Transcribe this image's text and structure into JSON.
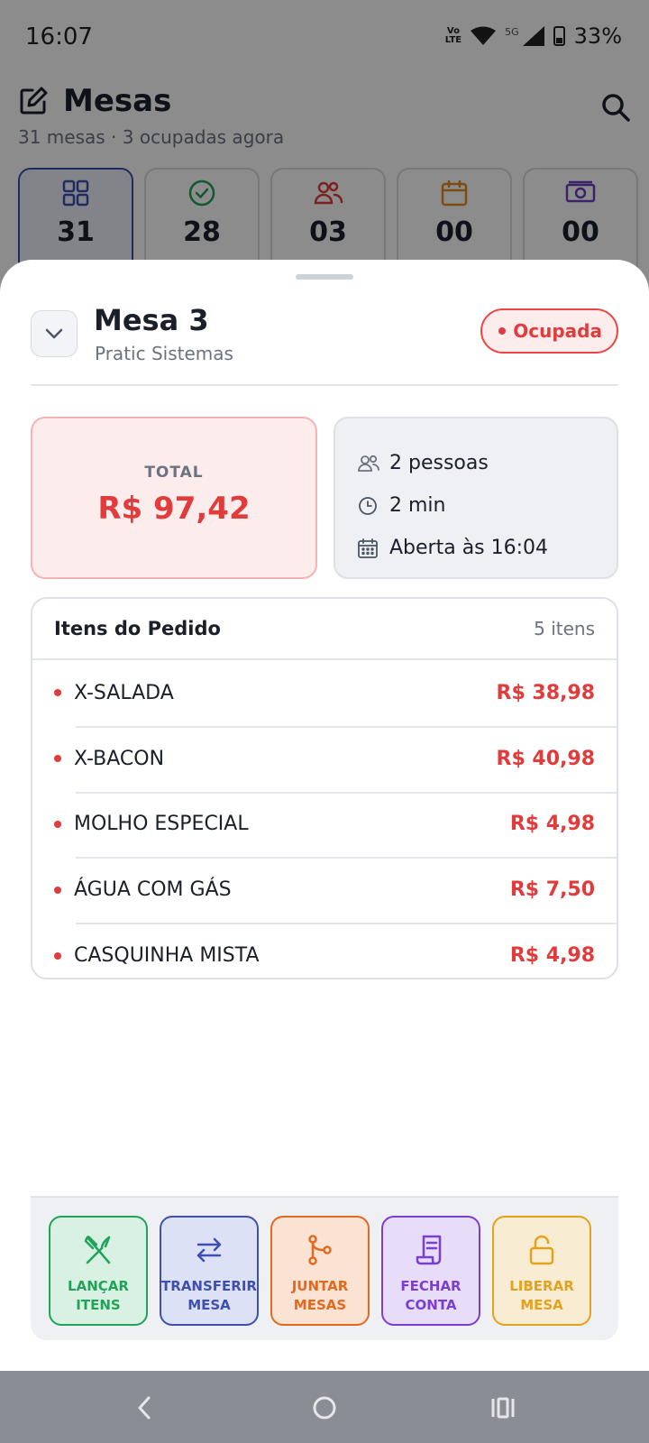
{
  "status_bar": {
    "time": "16:07",
    "volte_top": "Vo",
    "volte_bottom": "LTE",
    "network": "5G",
    "battery": "33%"
  },
  "page": {
    "title": "Mesas",
    "subtitle": "31 mesas · 3 ocupadas agora",
    "stats": [
      {
        "value": "31",
        "icon": "grid-icon",
        "color": "#3f4fb0"
      },
      {
        "value": "28",
        "icon": "check-circle-icon",
        "color": "#22a35a"
      },
      {
        "value": "03",
        "icon": "users-icon",
        "color": "#e23b3b"
      },
      {
        "value": "00",
        "icon": "calendar-icon",
        "color": "#e38a1a"
      },
      {
        "value": "00",
        "icon": "money-icon",
        "color": "#6b3fc4"
      }
    ]
  },
  "sheet": {
    "title": "Mesa 3",
    "subtitle": "Pratic Sistemas",
    "status_badge": "Ocupada",
    "total_label": "TOTAL",
    "total_value": "R$ 97,42",
    "info": {
      "people": "2 pessoas",
      "elapsed": "2 min",
      "opened": "Aberta às 16:04"
    },
    "items_title": "Itens do Pedido",
    "items_count": "5 itens",
    "items": [
      {
        "name": "X-SALADA",
        "price": "R$ 38,98"
      },
      {
        "name": "X-BACON",
        "price": "R$ 40,98"
      },
      {
        "name": "MOLHO ESPECIAL",
        "price": "R$ 4,98"
      },
      {
        "name": "ÁGUA COM GÁS",
        "price": "R$ 7,50"
      },
      {
        "name": "CASQUINHA MISTA",
        "price": "R$ 4,98"
      }
    ],
    "actions": [
      {
        "label": "LANÇAR\nITENS",
        "icon": "utensils-icon",
        "color": "#22a35a",
        "bg": "#d8f1e2"
      },
      {
        "label": "TRANSFERIR\nMESA",
        "icon": "swap-arrows-icon",
        "color": "#3f4fb0",
        "bg": "#dde1f6"
      },
      {
        "label": "JUNTAR\nMESAS",
        "icon": "merge-icon",
        "color": "#e2691f",
        "bg": "#fbe3d3"
      },
      {
        "label": "FECHAR\nCONTA",
        "icon": "receipt-icon",
        "color": "#7a3fd0",
        "bg": "#e8ddf8"
      },
      {
        "label": "LIBERAR\nMESA",
        "icon": "unlock-icon",
        "color": "#e6a11c",
        "bg": "#f8ecd3"
      }
    ]
  },
  "colors": {
    "accent_red": "#e23b3b",
    "muted_text": "#6b7280"
  }
}
